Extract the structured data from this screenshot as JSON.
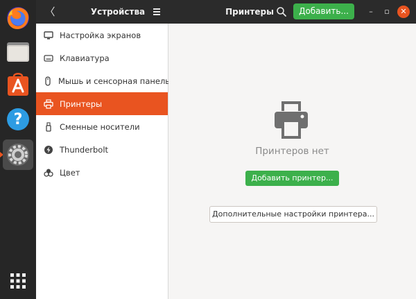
{
  "dock": {
    "items": [
      {
        "name": "firefox",
        "icon": "firefox-icon"
      },
      {
        "name": "files",
        "icon": "folder-icon"
      },
      {
        "name": "software",
        "icon": "software-store-icon"
      },
      {
        "name": "help",
        "icon": "help-icon",
        "glyph": "?"
      },
      {
        "name": "settings",
        "icon": "settings-gear-icon",
        "active": true
      },
      {
        "name": "app-grid",
        "icon": "app-grid-icon"
      }
    ],
    "accent": "#e95420"
  },
  "header": {
    "back_glyph": "〈",
    "left_title": "Устройства",
    "right_title": "Принтеры",
    "add_label": "Добавить...",
    "minimize_glyph": "–",
    "maximize_glyph": "▫",
    "close_glyph": "✕"
  },
  "sidebar": {
    "items": [
      {
        "label": "Настройка экранов",
        "icon": "display-icon"
      },
      {
        "label": "Клавиатура",
        "icon": "keyboard-icon"
      },
      {
        "label": "Мышь и сенсорная панель",
        "icon": "mouse-icon"
      },
      {
        "label": "Принтеры",
        "icon": "printer-icon",
        "active": true
      },
      {
        "label": "Сменные носители",
        "icon": "removable-media-icon"
      },
      {
        "label": "Thunderbolt",
        "icon": "thunderbolt-icon"
      },
      {
        "label": "Цвет",
        "icon": "color-icon"
      }
    ]
  },
  "main": {
    "empty_text": "Принтеров нет",
    "add_printer_label": "Добавить принтер...",
    "advanced_label": "Дополнительные настройки принтера..."
  },
  "colors": {
    "accent": "#e95420",
    "green": "#3cb04b",
    "panel_bg": "#f6f5f4",
    "header_bg": "#2b2b2b"
  }
}
